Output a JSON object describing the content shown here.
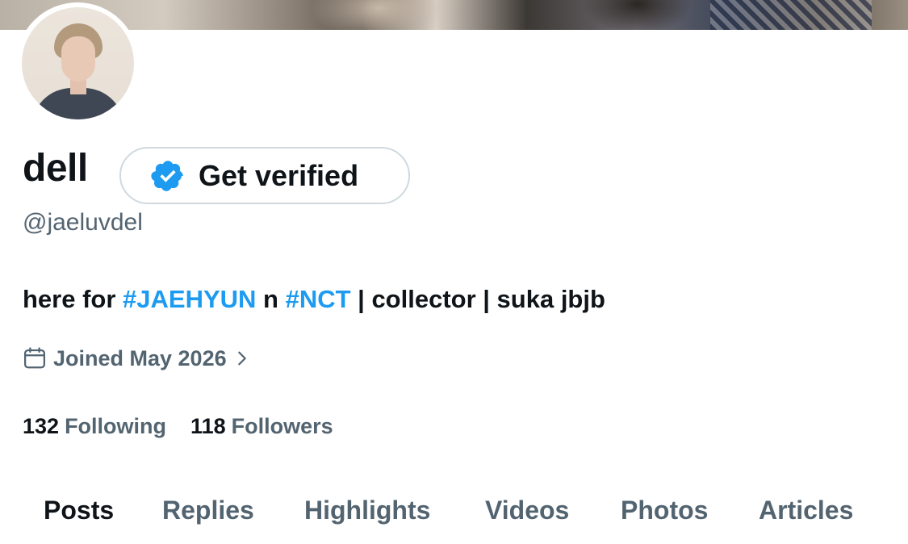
{
  "profile": {
    "display_name": "dell",
    "handle": "@jaeluvdel",
    "verify_label": "Get verified",
    "bio": {
      "part1": "here for ",
      "tag1": "#JAEHYUN",
      "part2": " n ",
      "tag2": "#NCT",
      "part3": " | collector | suka jbjb"
    },
    "joined": "Joined May 2026",
    "following_count": "132",
    "following_label": "Following",
    "followers_count": "118",
    "followers_label": "Followers"
  },
  "tabs": [
    {
      "label": "Posts",
      "active": true
    },
    {
      "label": "Replies",
      "active": false
    },
    {
      "label": "Highlights",
      "active": false
    },
    {
      "label": "Videos",
      "active": false
    },
    {
      "label": "Photos",
      "active": false
    },
    {
      "label": "Articles",
      "active": false
    }
  ],
  "icons": {
    "verified": "verified-badge-icon",
    "calendar": "calendar-icon",
    "chevron": "chevron-right-icon"
  },
  "colors": {
    "accent": "#1d9bf0",
    "text_primary": "#0f1419",
    "text_secondary": "#536471",
    "border": "#cfd9de"
  }
}
